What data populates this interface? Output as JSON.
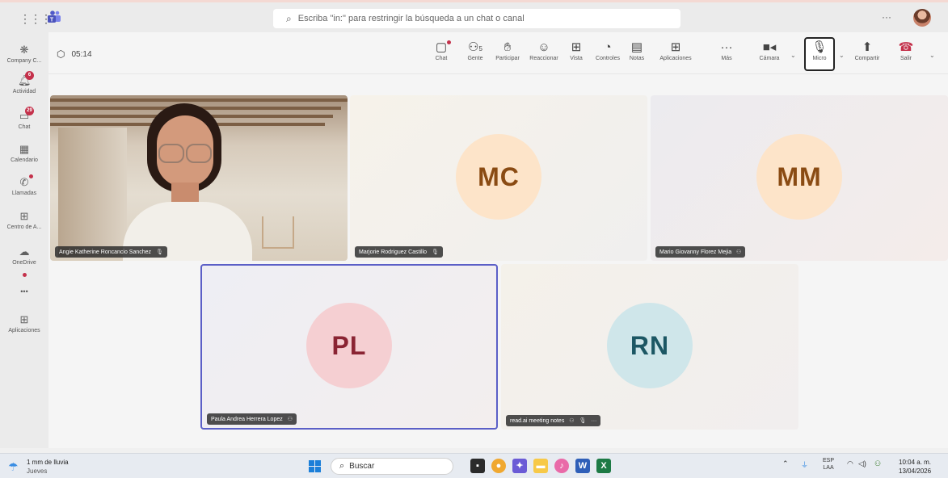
{
  "titlebar": {
    "search_placeholder": "Escriba \"in:\" para restringir la búsqueda a un chat o canal",
    "more": "···"
  },
  "rail": {
    "items": [
      {
        "label": "Company C...",
        "badge": ""
      },
      {
        "label": "Actividad",
        "badge": "6"
      },
      {
        "label": "Chat",
        "badge": "29"
      },
      {
        "label": "Calendario",
        "badge": ""
      },
      {
        "label": "Llamadas",
        "badge": ""
      },
      {
        "label": "Centro de A...",
        "badge": ""
      },
      {
        "label": "OneDrive",
        "badge": ""
      },
      {
        "label": "•••",
        "badge": ""
      },
      {
        "label": "Aplicaciones",
        "badge": ""
      }
    ]
  },
  "meeting": {
    "timer": "05:14",
    "people_count": "5",
    "controls": {
      "chat": "Chat",
      "people": "Gente",
      "raise": "Participar",
      "react": "Reaccionar",
      "view": "Vista",
      "controls": "Controles",
      "notes": "Notas",
      "apps": "Aplicaciones",
      "more": "Más",
      "camera": "Cámara",
      "mic": "Micro",
      "share": "Compartir",
      "leave": "Salir"
    },
    "participants": [
      {
        "name": "Angie Katherine Roncancio Sanchez",
        "initials": "",
        "video": true
      },
      {
        "name": "Marjorie Rodriguez Castillo",
        "initials": "MC"
      },
      {
        "name": "Mario Giovanny Florez Mejia",
        "initials": "MM"
      },
      {
        "name": "Paula Andrea Herrera Lopez",
        "initials": "PL"
      },
      {
        "name": "read.ai meeting notes",
        "initials": "RN"
      }
    ],
    "colors": {
      "mc_bg": "#fde4c9",
      "mc_fg": "#8a4b13",
      "mm_bg": "#fde4c9",
      "mm_fg": "#8a4b13",
      "pl_bg": "#f5cfd2",
      "pl_fg": "#8a2433",
      "rn_bg": "#cfe6ea",
      "rn_fg": "#1c5764",
      "speaker_border": "#5b5fc7"
    }
  },
  "taskbar": {
    "weather_line1": "1 mm de lluvia",
    "weather_line2": "Jueves",
    "search": "Buscar",
    "lang1": "ESP",
    "lang2": "LAA",
    "time": "10:04 a. m.",
    "date": "13/04/2026"
  }
}
